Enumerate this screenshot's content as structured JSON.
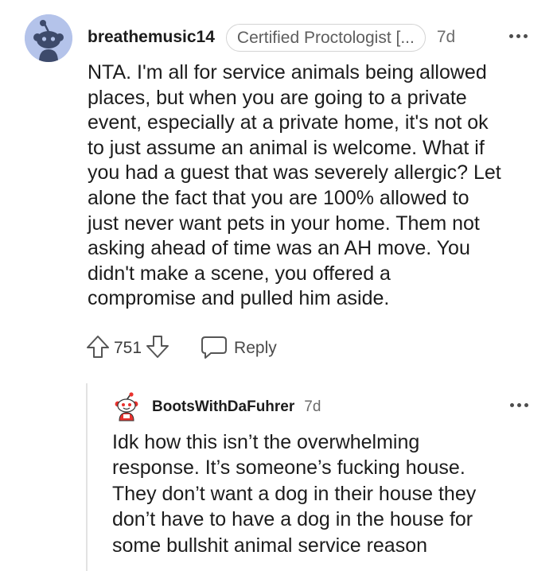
{
  "comment": {
    "username": "breathemusic14",
    "flair": "Certified Proctologist [...",
    "age": "7d",
    "body_lines": [
      "NTA. I'm all for service animals being allowed",
      "places, but when you are going to a private",
      "event, especially at a private home, it's not ok",
      "to just assume an animal is welcome. What if",
      "you had a guest that was severely allergic? Let",
      "alone the fact that you are 100% allowed to",
      "just never want pets in your home. Them not",
      "asking ahead of time was an AH move. You",
      "didn't make a scene, you offered a",
      "compromise and pulled him aside."
    ],
    "votes": "751",
    "reply_label": "Reply"
  },
  "reply": {
    "username": "BootsWithDaFuhrer",
    "age": "7d",
    "body_lines": [
      "Idk how this isn’t the overwhelming",
      "response. It’s someone’s fucking house.",
      "They don’t want a dog in their house they",
      "don’t have to have a dog in the house for",
      "some bullshit animal service reason"
    ]
  },
  "icons": {
    "avatar": "reddit-snoo-avatar",
    "reply_avatar": "reddit-snoo-red-avatar",
    "upvote": "upvote-arrow-icon",
    "downvote": "downvote-arrow-icon",
    "reply": "speech-bubble-icon",
    "more": "more-dots-icon"
  },
  "colors": {
    "avatar_bg": "#b4c3ea",
    "text": "#1c1c1c",
    "meta_text": "#6b6b6b",
    "flair_border": "#d4d4d4"
  }
}
